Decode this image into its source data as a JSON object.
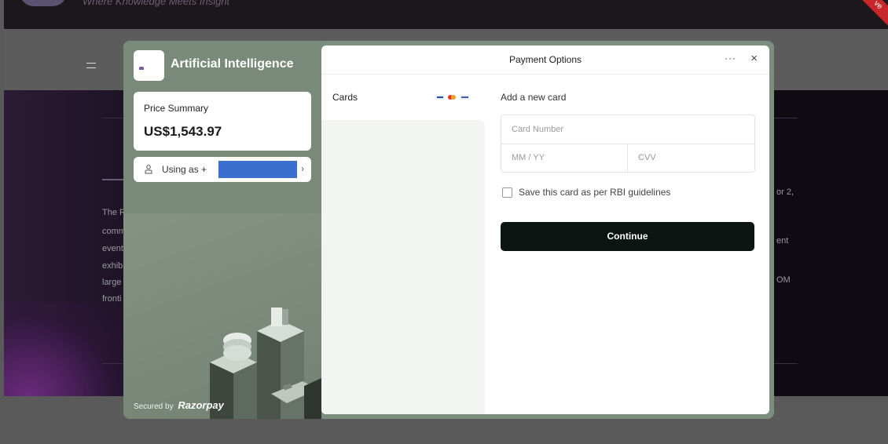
{
  "background": {
    "tagline": "Where Knowledge Meets Insight",
    "ribbon_text": "ve",
    "text_fragments": [
      "The R",
      "comm",
      "event",
      "exhib",
      "large",
      "fronti"
    ],
    "right_fragments": [
      "or 2,",
      "ent",
      "OM"
    ]
  },
  "merchant": {
    "name": "Artificial Intelligence"
  },
  "price_summary": {
    "label": "Price Summary",
    "amount": "US$1,543.97"
  },
  "user": {
    "prefix": "Using as +"
  },
  "footer": {
    "secured_by": "Secured by",
    "brand": "Razorpay"
  },
  "modal": {
    "title": "Payment Options",
    "more_label": "···",
    "close_label": "×"
  },
  "methods": {
    "cards_label": "Cards"
  },
  "card_form": {
    "title": "Add a new card",
    "card_number_placeholder": "Card Number",
    "expiry_placeholder": "MM / YY",
    "cvv_placeholder": "CVV",
    "save_label": "Save this card as per RBI guidelines",
    "continue_label": "Continue"
  },
  "colors": {
    "panel_green": "#7a8a7a",
    "button_dark": "#0c1511",
    "redaction_blue": "#3a6fd0"
  }
}
